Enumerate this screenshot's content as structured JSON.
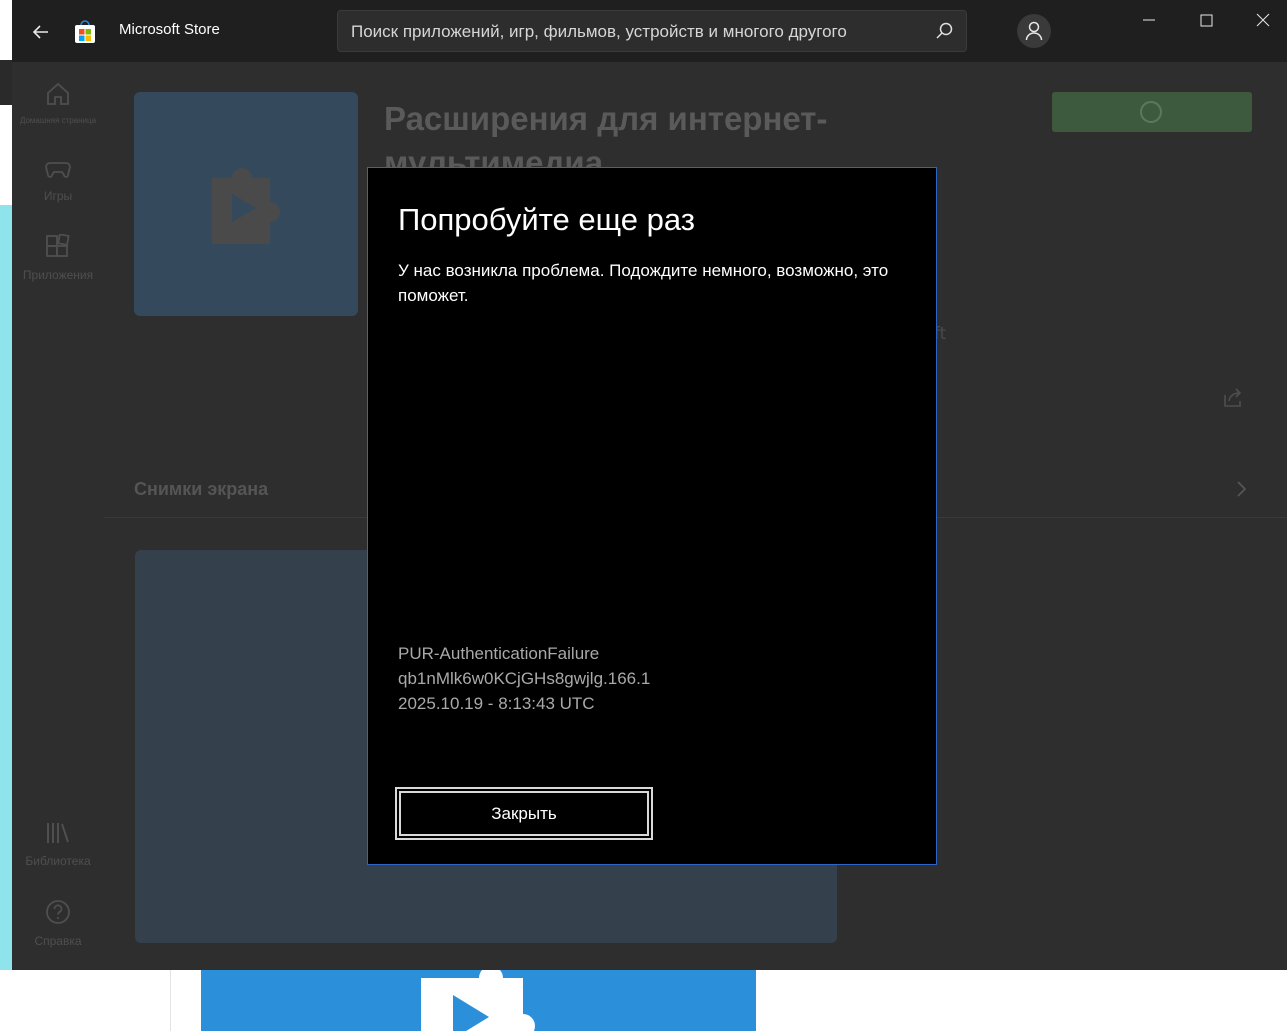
{
  "window": {
    "title": "Microsoft Store",
    "search_placeholder": "Поиск приложений, игр, фильмов, устройств и многого другого"
  },
  "nav": {
    "items": [
      {
        "label": "Домашняя страница",
        "icon": "home-icon"
      },
      {
        "label": "Игры",
        "icon": "gamepad-icon"
      },
      {
        "label": "Приложения",
        "icon": "apps-icon"
      },
      {
        "label": "Библиотека",
        "icon": "library-icon"
      },
      {
        "label": "Справка",
        "icon": "help-icon"
      }
    ]
  },
  "app": {
    "title_line1": "Расширения для интернет-",
    "title_line2": "мультимедиа",
    "publisher_fragment": "ft",
    "screenshots_label": "Снимки экрана"
  },
  "dialog": {
    "title": "Попробуйте еще раз",
    "message": "У нас возникла проблема. Подождите немного, возможно, это поможет.",
    "error_code": "PUR-AuthenticationFailure",
    "correlation_id": "qb1nMlk6w0KCjGHs8gwjlg.166.1",
    "timestamp": "2025.10.19 - 8:13:43 UTC",
    "close_label": "Закрыть"
  },
  "colors": {
    "dialog_border": "#2f64c7",
    "titlebar": "#1f1f1f",
    "background_tile": "#2b90d9"
  }
}
